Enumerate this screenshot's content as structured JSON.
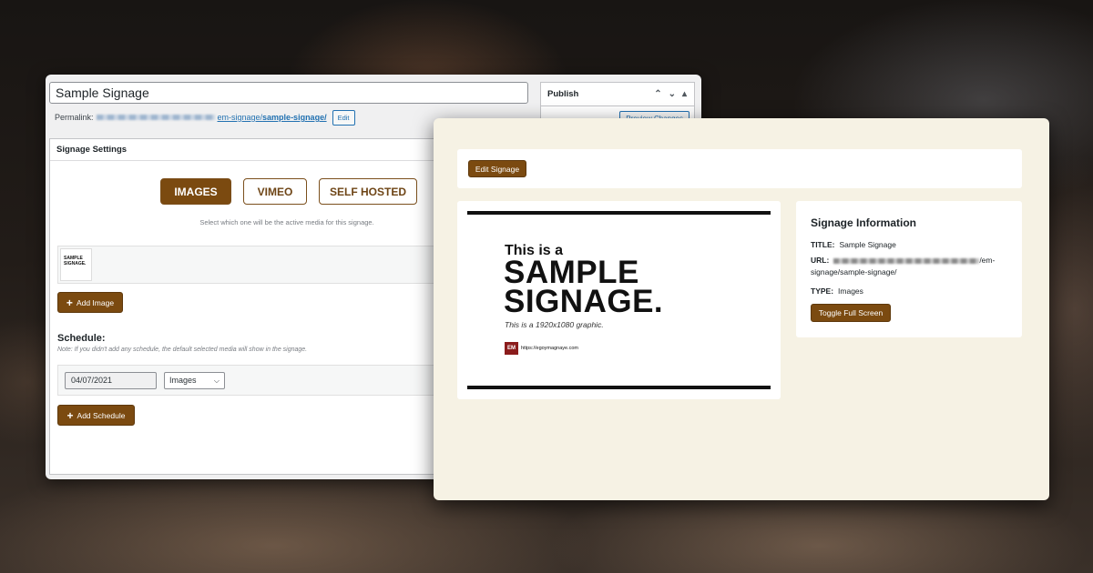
{
  "editor": {
    "post_title": "Sample Signage",
    "permalink_label": "Permalink:",
    "permalink_path": "em-signage/",
    "permalink_slug": "sample-signage/",
    "edit_label": "Edit",
    "publish_title": "Publish",
    "preview_label": "Preview Changes",
    "settings_title": "Signage Settings",
    "media_buttons": [
      {
        "label": "IMAGES",
        "active": true
      },
      {
        "label": "VIMEO",
        "active": false
      },
      {
        "label": "SELF HOSTED",
        "active": false
      }
    ],
    "media_hint": "Select which one will be the active media for this signage.",
    "thumb_text": "SAMPLE SIGNAGE.",
    "add_image_label": "Add Image",
    "schedule_label": "Schedule:",
    "schedule_note": "Note: If you didn't add any schedule, the default selected media will show in the signage.",
    "schedule_date": "04/07/2021",
    "schedule_media": "Images",
    "add_schedule_label": "Add Schedule"
  },
  "frontend": {
    "edit_signage_label": "Edit Signage",
    "signage": {
      "intro": "This is a",
      "line1": "SAMPLE",
      "line2": "SIGNAGE.",
      "caption": "This is a 1920x1080 graphic.",
      "logo_text": "EM",
      "url": "https://egoymagnaye.com"
    },
    "info": {
      "title": "Signage Information",
      "title_key": "TITLE:",
      "title_value": "Sample Signage",
      "url_key": "URL:",
      "url_suffix": "/em-",
      "url_line2": "signage/sample-signage/",
      "type_key": "TYPE:",
      "type_value": "Images",
      "toggle_label": "Toggle Full Screen"
    }
  },
  "colors": {
    "brand_brown": "#7b4a10",
    "frontend_bg": "#f6f2e4",
    "wp_link": "#2271b1"
  }
}
